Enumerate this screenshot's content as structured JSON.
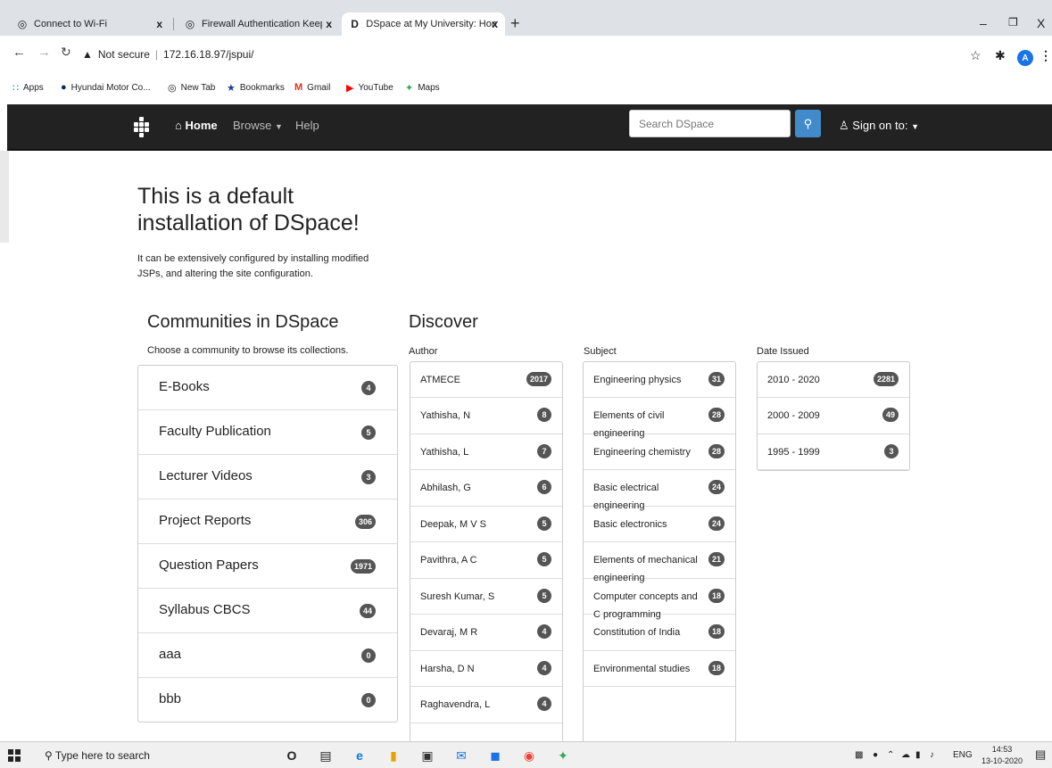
{
  "browser": {
    "tabs": [
      {
        "title": "Connect to Wi-Fi",
        "active": false
      },
      {
        "title": "Firewall Authentication Keepalive",
        "active": false
      },
      {
        "title": "DSpace at My University: Home",
        "active": true
      }
    ],
    "tab_close_glyph": "x",
    "new_tab_glyph": "+",
    "address": {
      "security_label": "Not secure",
      "url": "172.16.18.97/jspui/"
    },
    "profile_initial": "A",
    "bookmarks": [
      {
        "label": "Apps",
        "icon": "apps-grid-icon"
      },
      {
        "label": "Hyundai Motor Co...",
        "icon": "hyundai-icon"
      },
      {
        "label": "New Tab",
        "icon": "globe-icon"
      },
      {
        "label": "Bookmarks",
        "icon": "star-icon"
      },
      {
        "label": "Gmail",
        "icon": "gmail-icon"
      },
      {
        "label": "YouTube",
        "icon": "youtube-icon"
      },
      {
        "label": "Maps",
        "icon": "maps-icon"
      }
    ]
  },
  "navbar": {
    "home": "Home",
    "browse": "Browse",
    "help": "Help",
    "search_placeholder": "Search DSpace",
    "sign_on": "Sign on to:"
  },
  "jumbotron": {
    "title_line1": "This is a default",
    "title_line2": "installation of DSpace!",
    "text_line1": "It can be extensively configured by installing modified",
    "text_line2": "JSPs, and altering the site configuration."
  },
  "communities": {
    "heading": "Communities in DSpace",
    "subheading": "Choose a community to browse its collections.",
    "items": [
      {
        "label": "E-Books",
        "count": "4"
      },
      {
        "label": "Faculty Publication",
        "count": "5"
      },
      {
        "label": "Lecturer Videos",
        "count": "3"
      },
      {
        "label": "Project Reports",
        "count": "306"
      },
      {
        "label": "Question Papers",
        "count": "1971"
      },
      {
        "label": "Syllabus CBCS",
        "count": "44"
      },
      {
        "label": "aaa",
        "count": "0"
      },
      {
        "label": "bbb",
        "count": "0"
      }
    ]
  },
  "discover": {
    "heading": "Discover",
    "author": {
      "label": "Author",
      "items": [
        {
          "label": "ATMECE",
          "count": "2017"
        },
        {
          "label": "Yathisha, N",
          "count": "8"
        },
        {
          "label": "Yathisha, L",
          "count": "7"
        },
        {
          "label": "Abhilash, G",
          "count": "6"
        },
        {
          "label": "Deepak, M V S",
          "count": "5"
        },
        {
          "label": "Pavithra, A C",
          "count": "5"
        },
        {
          "label": "Suresh Kumar, S",
          "count": "5"
        },
        {
          "label": "Devaraj, M R",
          "count": "4"
        },
        {
          "label": "Harsha, D N",
          "count": "4"
        },
        {
          "label": "Raghavendra, L",
          "count": "4"
        }
      ]
    },
    "subject": {
      "label": "Subject",
      "items": [
        {
          "label": "Engineering physics",
          "count": "31"
        },
        {
          "label": "Elements of civil engineering",
          "count": "28"
        },
        {
          "label": "Engineering chemistry",
          "count": "28"
        },
        {
          "label": "Basic electrical engineering",
          "count": "24"
        },
        {
          "label": "Basic electronics",
          "count": "24"
        },
        {
          "label": "Elements of mechanical engineering",
          "count": "21"
        },
        {
          "label": "Computer concepts and C programming",
          "count": "18"
        },
        {
          "label": "Constitution of India",
          "count": "18"
        },
        {
          "label": "Environmental studies",
          "count": "18"
        }
      ]
    },
    "date": {
      "label": "Date Issued",
      "items": [
        {
          "label": "2010 - 2020",
          "count": "2281"
        },
        {
          "label": "2000 - 2009",
          "count": "49"
        },
        {
          "label": "1995 - 1999",
          "count": "3"
        }
      ]
    }
  },
  "taskbar": {
    "search_placeholder": "Type here to search",
    "lang": "ENG",
    "time": "14:53",
    "date": "13-10-2020"
  }
}
